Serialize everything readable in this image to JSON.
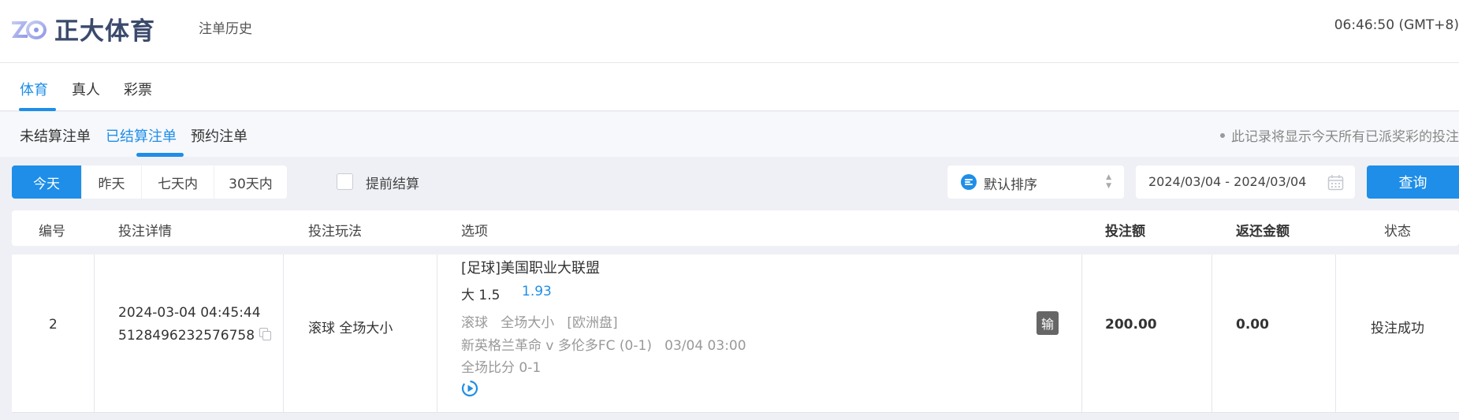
{
  "header": {
    "brand_name": "正大体育",
    "nav_link": "注单历史",
    "clock": "06:46:50 (GMT+8)"
  },
  "product_tabs": [
    "体育",
    "真人",
    "彩票"
  ],
  "bet_tabs": [
    "未结算注单",
    "已结算注单",
    "预约注单"
  ],
  "notice": "此记录将显示今天所有已派奖彩的投注",
  "filters": {
    "ranges": [
      "今天",
      "昨天",
      "七天内",
      "30天内"
    ],
    "early_settle_label": "提前结算",
    "early_settle_checked": false,
    "sort_label": "默认排序",
    "date_range": "2024/03/04 - 2024/03/04",
    "query_label": "查询"
  },
  "table": {
    "headers": [
      "编号",
      "投注详情",
      "投注玩法",
      "选项",
      "投注额",
      "返还金额",
      "状态"
    ],
    "rows": [
      {
        "no": "2",
        "time": "2024-03-04 04:45:44",
        "ticket": "5128496232576758",
        "play": "滚球 全场大小",
        "league": "[足球]美国职业大联盟",
        "selection": "大 1.5",
        "odds": "1.93",
        "market": "滚球   全场大小   [欧洲盘]",
        "match": "新英格兰革命 v 多伦多FC (0-1)   03/04 03:00",
        "score": "全场比分 0-1",
        "result": "输",
        "stake": "200.00",
        "returned": "0.00",
        "status": "投注成功"
      }
    ]
  },
  "colors": {
    "accent": "#1e8ee8",
    "brand_text": "#3b4a6b",
    "lose_badge": "#666666"
  }
}
